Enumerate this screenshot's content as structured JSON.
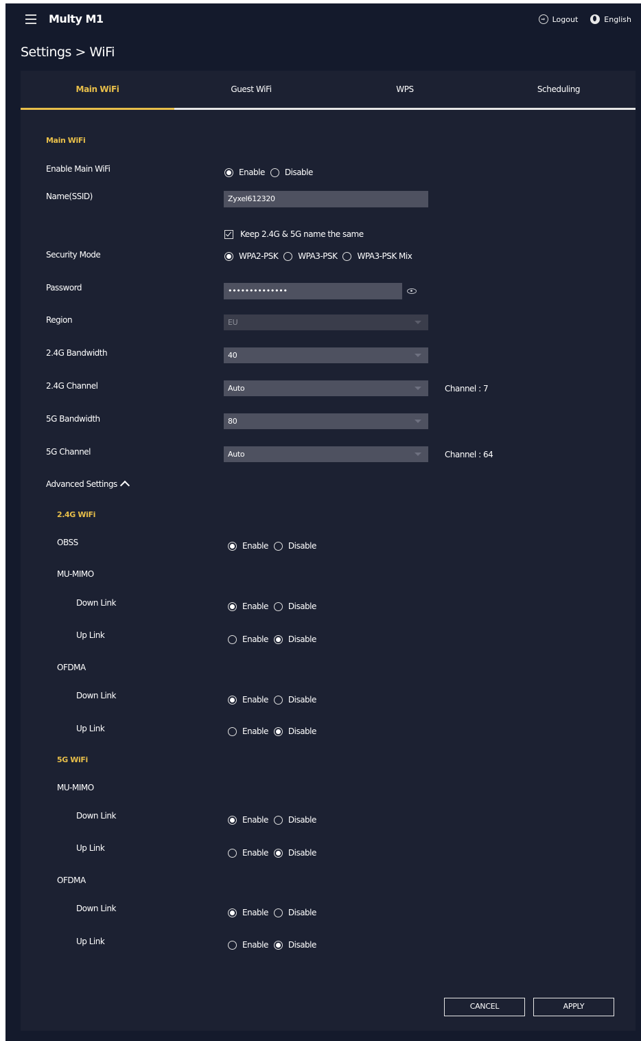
{
  "header": {
    "app_title": "Multy M1",
    "logout_label": "Logout",
    "language_label": "English",
    "page_title": "Settings > WiFi"
  },
  "tabs": [
    {
      "label": "Main WiFi",
      "active": true
    },
    {
      "label": "Guest WiFi",
      "active": false
    },
    {
      "label": "WPS",
      "active": false
    },
    {
      "label": "Scheduling",
      "active": false
    }
  ],
  "main_wifi": {
    "section_title": "Main WiFi",
    "enable_label": "Enable Main WiFi",
    "enable_options": [
      "Enable",
      "Disable"
    ],
    "enable_selected": "Enable",
    "ssid_label": "Name(SSID)",
    "ssid_value": "Zyxel612320",
    "keep_same_label": "Keep 2.4G & 5G name the same",
    "keep_same_checked": true,
    "security_label": "Security Mode",
    "security_options": [
      "WPA2-PSK",
      "WPA3-PSK",
      "WPA3-PSK Mix"
    ],
    "security_selected": "WPA2-PSK",
    "password_label": "Password",
    "password_value": "••••••••••••••",
    "region_label": "Region",
    "region_value": "EU",
    "bw24_label": "2.4G Bandwidth",
    "bw24_value": "40",
    "ch24_label": "2.4G Channel",
    "ch24_value": "Auto",
    "ch24_info": "Channel : 7",
    "bw5_label": "5G Bandwidth",
    "bw5_value": "80",
    "ch5_label": "5G Channel",
    "ch5_value": "Auto",
    "ch5_info": "Channel : 64"
  },
  "advanced": {
    "label": "Advanced Settings",
    "wifi24_title": "2.4G WiFi",
    "wifi5_title": "5G WiFi",
    "obss_label": "OBSS",
    "mumimo_label": "MU-MIMO",
    "ofdma_label": "OFDMA",
    "down_link_label": "Down Link",
    "up_link_label": "Up Link",
    "enable_label": "Enable",
    "disable_label": "Disable"
  },
  "buttons": {
    "cancel_label": "CANCEL",
    "apply_label": "APPLY"
  },
  "colors": {
    "background": "#141a2c",
    "panel": "#1c2132",
    "accent": "#e8bf4a",
    "input": "#4e5160"
  }
}
